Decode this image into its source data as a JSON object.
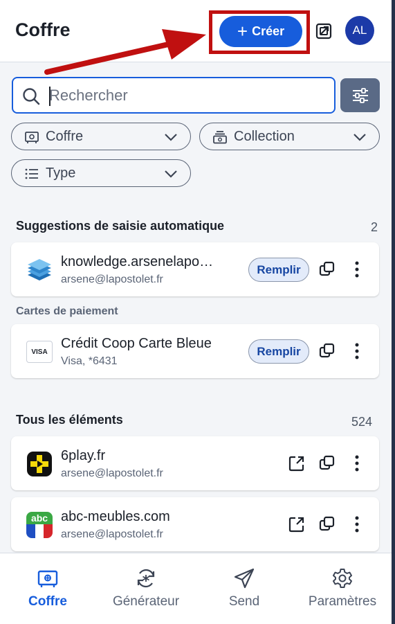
{
  "header": {
    "title": "Coffre",
    "create_label": "Créer",
    "avatar_initials": "AL"
  },
  "search": {
    "placeholder": "Rechercher",
    "value": ""
  },
  "filters": {
    "vault": "Coffre",
    "collection": "Collection",
    "type": "Type"
  },
  "autofill": {
    "title": "Suggestions de saisie automatique",
    "count": "2",
    "items": [
      {
        "name": "knowledge.arsenelapo…",
        "sub": "arsene@lapostolet.fr",
        "action": "Remplir",
        "icon": "stack-logo-icon"
      }
    ],
    "cards_subtitle": "Cartes de paiement",
    "cards": [
      {
        "name": "Crédit Coop Carte Bleue",
        "sub": "Visa, *6431",
        "action": "Remplir",
        "brand": "VISA",
        "icon": "visa-icon"
      }
    ]
  },
  "all": {
    "title": "Tous les éléments",
    "count": "524",
    "items": [
      {
        "name": "6play.fr",
        "sub": "arsene@lapostolet.fr",
        "icon": "6play-logo-icon"
      },
      {
        "name": "abc-meubles.com",
        "sub": "arsene@lapostolet.fr",
        "icon": "abc-logo-icon",
        "logo_text": "abc"
      }
    ]
  },
  "nav": {
    "vault": "Coffre",
    "generator": "Générateur",
    "send": "Send",
    "settings": "Paramètres",
    "active": "vault"
  },
  "colors": {
    "primary": "#175ddc",
    "highlight": "#c01010",
    "avatar": "#1c3aa8",
    "filter_button": "#5a6a86"
  }
}
